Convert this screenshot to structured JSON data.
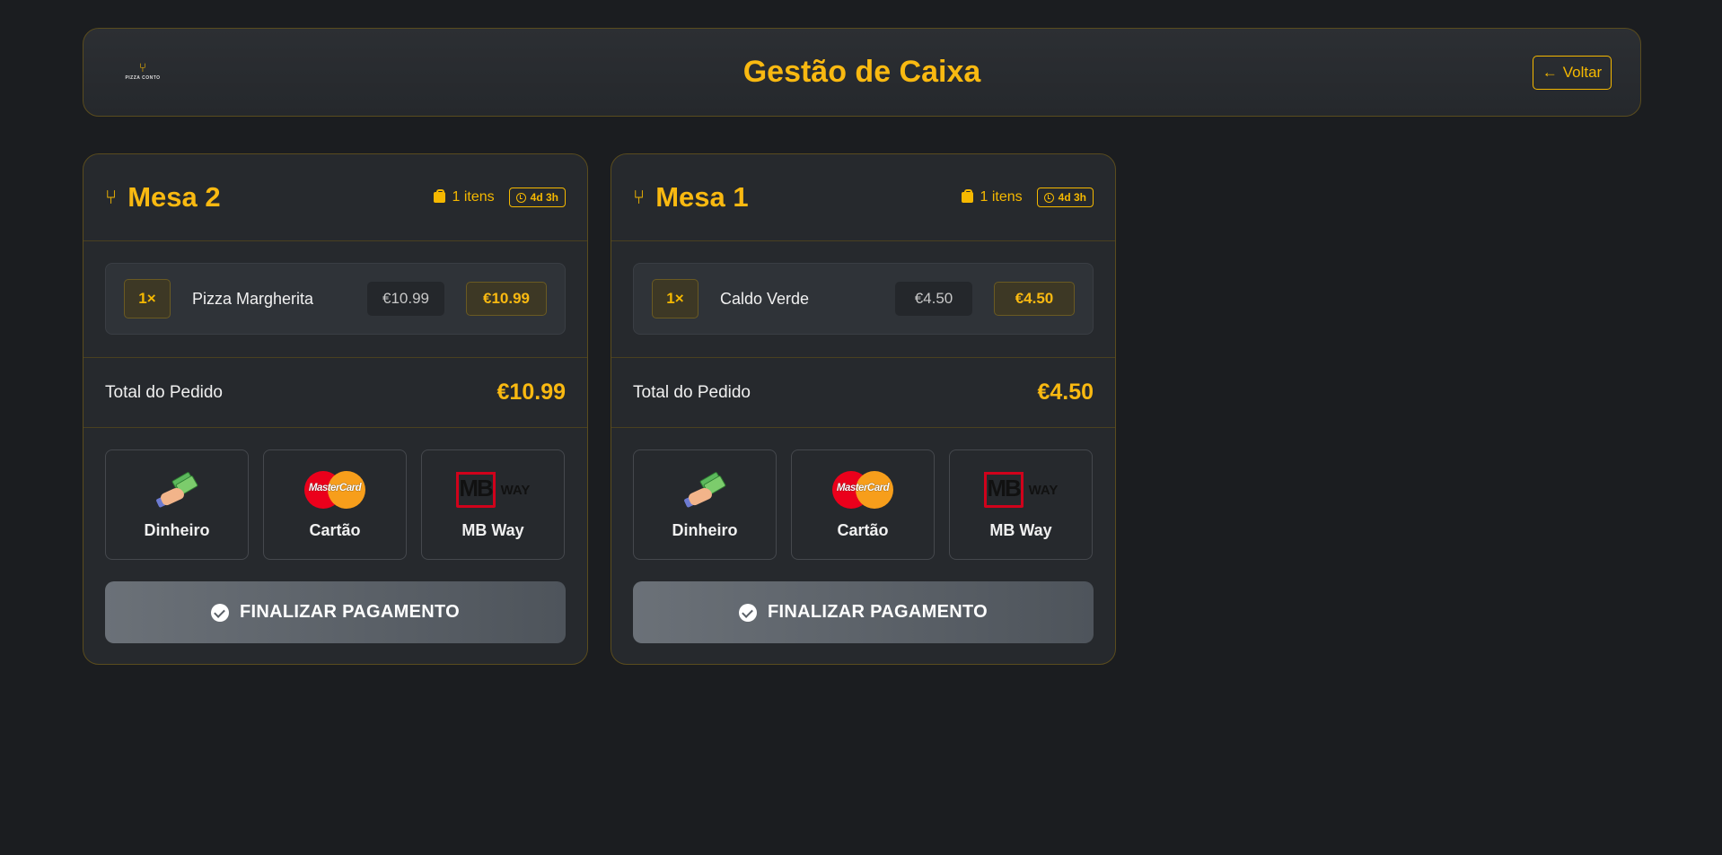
{
  "header": {
    "logo_icon": "⑂",
    "logo_text": "PIZZA CONTO",
    "title": "Gestão de Caixa",
    "back_label": "Voltar",
    "back_icon": "←"
  },
  "colors": {
    "accent": "#f9b911",
    "background": "#1b1d20",
    "card": "#26292d",
    "border": "#5a4c1e"
  },
  "cards": [
    {
      "mesa": "Mesa 2",
      "items_count": "1 itens",
      "time": "4d 3h",
      "items": [
        {
          "qty": "1×",
          "name": "Pizza Margherita",
          "unit_price": "€10.99",
          "line_total": "€10.99"
        }
      ],
      "total_label": "Total do Pedido",
      "total": "€10.99",
      "payment_options": [
        {
          "label": "Dinheiro",
          "icon": "cash-icon"
        },
        {
          "label": "Cartão",
          "icon": "mastercard-icon",
          "brand_text": "MasterCard"
        },
        {
          "label": "MB Way",
          "icon": "mbway-icon",
          "brand_text": "MB",
          "brand_sub": "WAY"
        }
      ],
      "finalize_label": "FINALIZAR PAGAMENTO"
    },
    {
      "mesa": "Mesa 1",
      "items_count": "1 itens",
      "time": "4d 3h",
      "items": [
        {
          "qty": "1×",
          "name": "Caldo Verde",
          "unit_price": "€4.50",
          "line_total": "€4.50"
        }
      ],
      "total_label": "Total do Pedido",
      "total": "€4.50",
      "payment_options": [
        {
          "label": "Dinheiro",
          "icon": "cash-icon"
        },
        {
          "label": "Cartão",
          "icon": "mastercard-icon",
          "brand_text": "MasterCard"
        },
        {
          "label": "MB Way",
          "icon": "mbway-icon",
          "brand_text": "MB",
          "brand_sub": "WAY"
        }
      ],
      "finalize_label": "FINALIZAR PAGAMENTO"
    }
  ]
}
